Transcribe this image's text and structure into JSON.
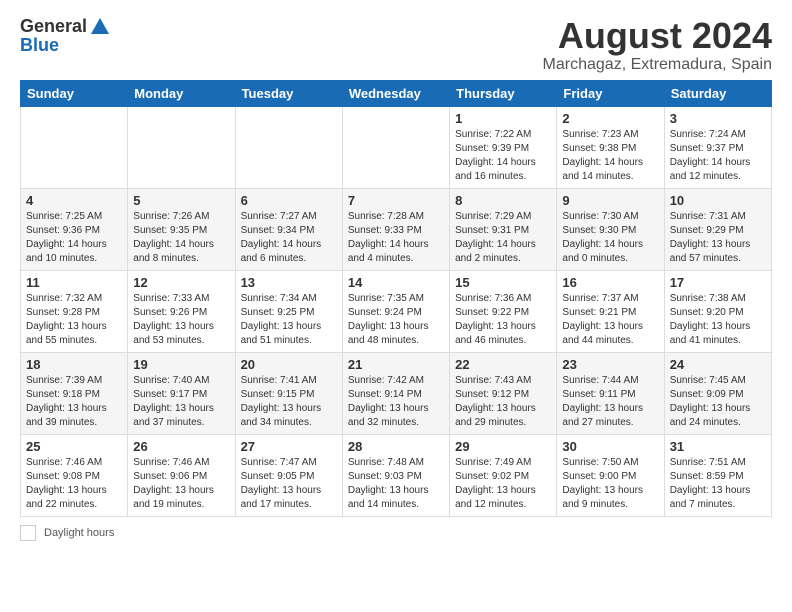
{
  "header": {
    "logo_general": "General",
    "logo_blue": "Blue",
    "main_title": "August 2024",
    "subtitle": "Marchagaz, Extremadura, Spain"
  },
  "days_of_week": [
    "Sunday",
    "Monday",
    "Tuesday",
    "Wednesday",
    "Thursday",
    "Friday",
    "Saturday"
  ],
  "weeks": [
    [
      {
        "num": "",
        "info": ""
      },
      {
        "num": "",
        "info": ""
      },
      {
        "num": "",
        "info": ""
      },
      {
        "num": "",
        "info": ""
      },
      {
        "num": "1",
        "info": "Sunrise: 7:22 AM\nSunset: 9:39 PM\nDaylight: 14 hours\nand 16 minutes."
      },
      {
        "num": "2",
        "info": "Sunrise: 7:23 AM\nSunset: 9:38 PM\nDaylight: 14 hours\nand 14 minutes."
      },
      {
        "num": "3",
        "info": "Sunrise: 7:24 AM\nSunset: 9:37 PM\nDaylight: 14 hours\nand 12 minutes."
      }
    ],
    [
      {
        "num": "4",
        "info": "Sunrise: 7:25 AM\nSunset: 9:36 PM\nDaylight: 14 hours\nand 10 minutes."
      },
      {
        "num": "5",
        "info": "Sunrise: 7:26 AM\nSunset: 9:35 PM\nDaylight: 14 hours\nand 8 minutes."
      },
      {
        "num": "6",
        "info": "Sunrise: 7:27 AM\nSunset: 9:34 PM\nDaylight: 14 hours\nand 6 minutes."
      },
      {
        "num": "7",
        "info": "Sunrise: 7:28 AM\nSunset: 9:33 PM\nDaylight: 14 hours\nand 4 minutes."
      },
      {
        "num": "8",
        "info": "Sunrise: 7:29 AM\nSunset: 9:31 PM\nDaylight: 14 hours\nand 2 minutes."
      },
      {
        "num": "9",
        "info": "Sunrise: 7:30 AM\nSunset: 9:30 PM\nDaylight: 14 hours\nand 0 minutes."
      },
      {
        "num": "10",
        "info": "Sunrise: 7:31 AM\nSunset: 9:29 PM\nDaylight: 13 hours\nand 57 minutes."
      }
    ],
    [
      {
        "num": "11",
        "info": "Sunrise: 7:32 AM\nSunset: 9:28 PM\nDaylight: 13 hours\nand 55 minutes."
      },
      {
        "num": "12",
        "info": "Sunrise: 7:33 AM\nSunset: 9:26 PM\nDaylight: 13 hours\nand 53 minutes."
      },
      {
        "num": "13",
        "info": "Sunrise: 7:34 AM\nSunset: 9:25 PM\nDaylight: 13 hours\nand 51 minutes."
      },
      {
        "num": "14",
        "info": "Sunrise: 7:35 AM\nSunset: 9:24 PM\nDaylight: 13 hours\nand 48 minutes."
      },
      {
        "num": "15",
        "info": "Sunrise: 7:36 AM\nSunset: 9:22 PM\nDaylight: 13 hours\nand 46 minutes."
      },
      {
        "num": "16",
        "info": "Sunrise: 7:37 AM\nSunset: 9:21 PM\nDaylight: 13 hours\nand 44 minutes."
      },
      {
        "num": "17",
        "info": "Sunrise: 7:38 AM\nSunset: 9:20 PM\nDaylight: 13 hours\nand 41 minutes."
      }
    ],
    [
      {
        "num": "18",
        "info": "Sunrise: 7:39 AM\nSunset: 9:18 PM\nDaylight: 13 hours\nand 39 minutes."
      },
      {
        "num": "19",
        "info": "Sunrise: 7:40 AM\nSunset: 9:17 PM\nDaylight: 13 hours\nand 37 minutes."
      },
      {
        "num": "20",
        "info": "Sunrise: 7:41 AM\nSunset: 9:15 PM\nDaylight: 13 hours\nand 34 minutes."
      },
      {
        "num": "21",
        "info": "Sunrise: 7:42 AM\nSunset: 9:14 PM\nDaylight: 13 hours\nand 32 minutes."
      },
      {
        "num": "22",
        "info": "Sunrise: 7:43 AM\nSunset: 9:12 PM\nDaylight: 13 hours\nand 29 minutes."
      },
      {
        "num": "23",
        "info": "Sunrise: 7:44 AM\nSunset: 9:11 PM\nDaylight: 13 hours\nand 27 minutes."
      },
      {
        "num": "24",
        "info": "Sunrise: 7:45 AM\nSunset: 9:09 PM\nDaylight: 13 hours\nand 24 minutes."
      }
    ],
    [
      {
        "num": "25",
        "info": "Sunrise: 7:46 AM\nSunset: 9:08 PM\nDaylight: 13 hours\nand 22 minutes."
      },
      {
        "num": "26",
        "info": "Sunrise: 7:46 AM\nSunset: 9:06 PM\nDaylight: 13 hours\nand 19 minutes."
      },
      {
        "num": "27",
        "info": "Sunrise: 7:47 AM\nSunset: 9:05 PM\nDaylight: 13 hours\nand 17 minutes."
      },
      {
        "num": "28",
        "info": "Sunrise: 7:48 AM\nSunset: 9:03 PM\nDaylight: 13 hours\nand 14 minutes."
      },
      {
        "num": "29",
        "info": "Sunrise: 7:49 AM\nSunset: 9:02 PM\nDaylight: 13 hours\nand 12 minutes."
      },
      {
        "num": "30",
        "info": "Sunrise: 7:50 AM\nSunset: 9:00 PM\nDaylight: 13 hours\nand 9 minutes."
      },
      {
        "num": "31",
        "info": "Sunrise: 7:51 AM\nSunset: 8:59 PM\nDaylight: 13 hours\nand 7 minutes."
      }
    ]
  ],
  "footer": {
    "label": "Daylight hours"
  }
}
